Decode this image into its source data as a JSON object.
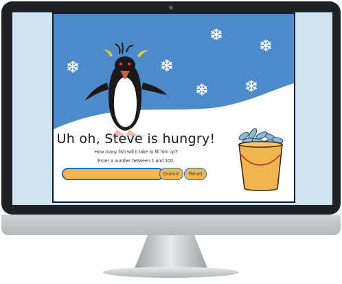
{
  "game": {
    "headline": "Uh oh, Steve is hungry!",
    "prompt_line1": "How many fish will it take to fill him up?",
    "prompt_line2": "Enter a number between 1 and 100.",
    "input_value": "",
    "guess_label": "Guess!",
    "reset_label": "Reset"
  },
  "colors": {
    "sky": "#4d8ac9",
    "snow": "#ffffff",
    "accent_orange": "#f2b650",
    "accent_blue": "#2b6fa8",
    "bezel": "#1f2224"
  },
  "icons": [
    "snowflake-icon",
    "penguin-illustration",
    "fish-bucket-illustration"
  ]
}
